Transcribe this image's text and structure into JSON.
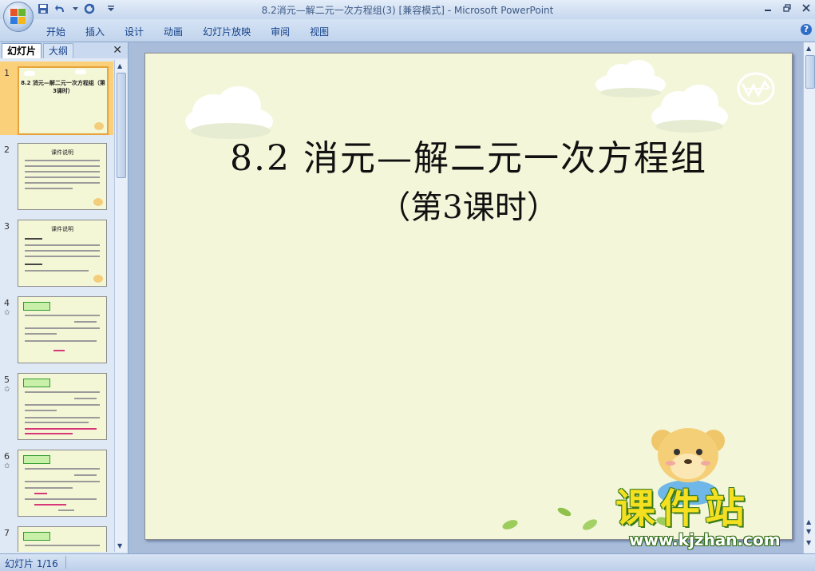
{
  "window": {
    "title": "8.2消元—解二元一次方程组(3) [兼容模式] - Microsoft PowerPoint"
  },
  "ribbon": {
    "tabs": [
      "开始",
      "插入",
      "设计",
      "动画",
      "幻灯片放映",
      "审阅",
      "视图"
    ]
  },
  "left_pane": {
    "tabs": [
      "幻灯片",
      "大纲"
    ],
    "selected_slide": 1,
    "thumbnails": [
      {
        "number": "1",
        "title": "8.2 消元—解二元一次方程组（第3课时）"
      },
      {
        "number": "2",
        "title": "课件说明"
      },
      {
        "number": "3",
        "title": "课件说明"
      },
      {
        "number": "4",
        "title": ""
      },
      {
        "number": "5",
        "title": ""
      },
      {
        "number": "6",
        "title": ""
      },
      {
        "number": "7",
        "title": ""
      }
    ]
  },
  "slide": {
    "title": "8.2 消元—解二元一次方程组",
    "subtitle": "（第3课时）"
  },
  "watermark": {
    "text": "课件站",
    "url": "www.kjzhan.com"
  },
  "status": {
    "slide_indicator": "幻灯片 1/16"
  },
  "colors": {
    "slide_background": "#f3f6d9",
    "selection": "#fbd07a",
    "ribbon": "#c1d4ec",
    "watermark_yellow": "#f4e020",
    "watermark_green": "#3a7a1a"
  }
}
